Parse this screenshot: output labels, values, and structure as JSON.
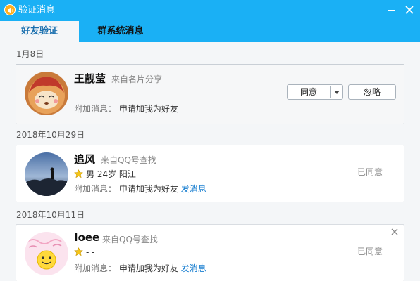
{
  "window": {
    "title": "验证消息",
    "colors": {
      "titlebar": "#1ab0f5",
      "link": "#1a7fd0"
    }
  },
  "tabs": [
    {
      "label": "好友验证",
      "active": true
    },
    {
      "label": "群系统消息",
      "active": false
    }
  ],
  "requests": [
    {
      "date": "1月8日",
      "name": "王靓莹",
      "source": "来自名片分享",
      "info": "-  -",
      "extra_label": "附加消息：",
      "extra_message": "申请加我为好友",
      "agree_label": "同意",
      "ignore_label": "忽略"
    },
    {
      "date": "2018年10月29日",
      "name": "追风",
      "source": "来自QQ号查找",
      "info": "男 24岁 阳江",
      "extra_label": "附加消息：",
      "extra_message": "申请加我为好友",
      "send_message_label": "发消息",
      "status": "已同意"
    },
    {
      "date": "2018年10月11日",
      "name": "Ioee",
      "source": "来自QQ号查找",
      "info": "-  -",
      "extra_label": "附加消息：",
      "extra_message": "申请加我为好友",
      "send_message_label": "发消息",
      "status": "已同意"
    }
  ]
}
